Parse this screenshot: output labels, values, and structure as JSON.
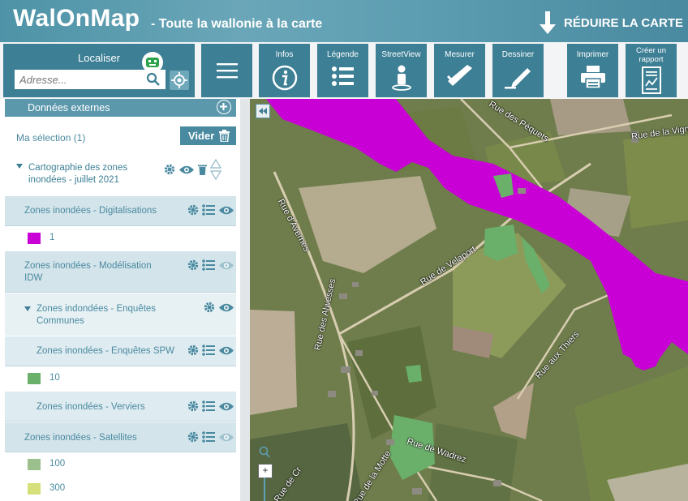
{
  "header": {
    "brand": "WalOnMap",
    "subtitle": "- Toute la wallonie à la carte",
    "reduce_label": "RÉDUIRE LA CARTE"
  },
  "toolbar": {
    "localiser_label": "Localiser",
    "address_placeholder": "Adresse...",
    "tools": [
      {
        "label": "Infos",
        "icon": "info-icon"
      },
      {
        "label": "Légende",
        "icon": "list-icon"
      },
      {
        "label": "StreetView",
        "icon": "person-icon"
      },
      {
        "label": "Mesurer",
        "icon": "ruler-icon"
      },
      {
        "label": "Dessiner",
        "icon": "pencil-icon"
      },
      {
        "label": "Imprimer",
        "icon": "printer-icon"
      },
      {
        "label": "Créer un rapport",
        "icon": "report-icon"
      }
    ]
  },
  "sidebar": {
    "external_data": "Données externes",
    "selection": "Ma sélection (1)",
    "clear_label": "Vider",
    "group_title": "Cartographie des zones inondées - juillet 2021",
    "layers": [
      {
        "title": "Zones inondées - Digitalisations",
        "legend": [
          {
            "label": "1",
            "color": "#c800d6"
          }
        ]
      },
      {
        "title": "Zones inondées - Modélisation IDW"
      },
      {
        "title": "Zones indondées - Enquêtes Communes"
      },
      {
        "title": "Zones inondées - Enquêtes SPW",
        "legend": [
          {
            "label": "10",
            "color": "#6ab06a"
          }
        ]
      },
      {
        "title": "Zones inondées - Verviers"
      },
      {
        "title": "Zones inondées - Satellites",
        "legend": [
          {
            "label": "100",
            "color": "#9cbf8e"
          },
          {
            "label": "300",
            "color": "#d6e07a"
          }
        ]
      }
    ]
  },
  "map": {
    "roads": [
      "Rue des Péquets",
      "Rue de la Vign",
      "Rue d'Avernes",
      "Rue de Velaport",
      "Rue des Alwesses",
      "Rue aux Thiers",
      "Rue de la Motte",
      "Rue de Wadrez",
      "Rue de Cr"
    ]
  },
  "colors": {
    "primary": "#3d7f95",
    "flood_digitalisation": "#c800d6",
    "flood_spw": "#6ab06a"
  }
}
